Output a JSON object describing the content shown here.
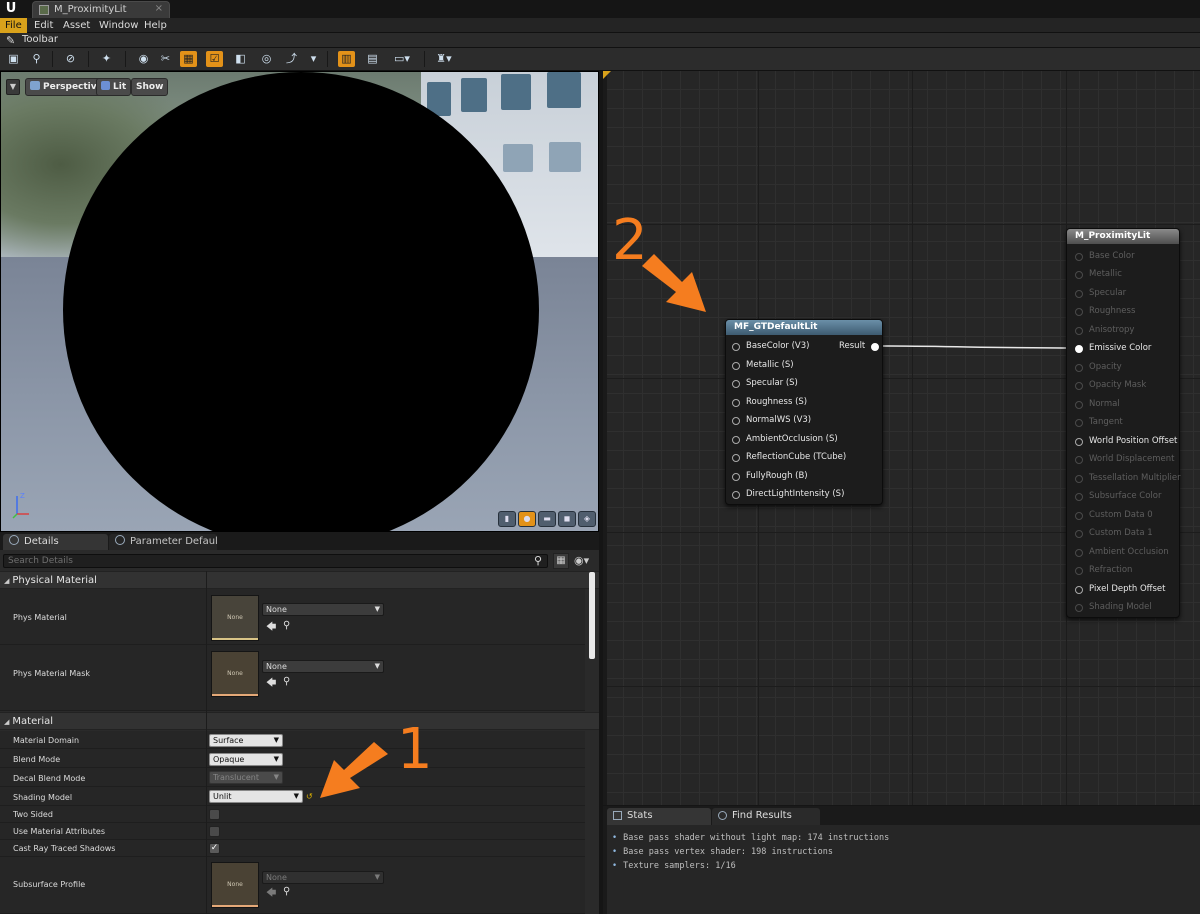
{
  "window": {
    "logo": "U",
    "tab_title": "M_ProximityLit",
    "close_glyph": "×"
  },
  "menu": [
    "File",
    "Edit",
    "Asset",
    "Window",
    "Help"
  ],
  "toolbar": {
    "tab_label": "Toolbar"
  },
  "viewport": {
    "perspective_label": "Perspective",
    "lit_label": "Lit",
    "show_label": "Show"
  },
  "details": {
    "tabs": [
      "Details",
      "Parameter Defaults"
    ],
    "search_placeholder": "Search Details",
    "physical_material": {
      "header": "Physical Material",
      "phys_material_label": "Phys Material",
      "phys_material_value": "None",
      "phys_material_thumb": "None",
      "phys_material_mask_label": "Phys Material Mask",
      "phys_material_mask_value": "None",
      "phys_material_mask_thumb": "None"
    },
    "material": {
      "header": "Material",
      "rows": [
        {
          "label": "Material Domain",
          "value": "Surface"
        },
        {
          "label": "Blend Mode",
          "value": "Opaque"
        },
        {
          "label": "Decal Blend Mode",
          "value": "Translucent"
        },
        {
          "label": "Shading Model",
          "value": "Unlit"
        },
        {
          "label": "Two Sided",
          "checked": false
        },
        {
          "label": "Use Material Attributes",
          "checked": false
        },
        {
          "label": "Cast Ray Traced Shadows",
          "checked": true
        }
      ],
      "subsurface_label": "Subsurface Profile",
      "subsurface_value": "None",
      "subsurface_thumb": "None"
    }
  },
  "graph": {
    "function_node": {
      "title": "MF_GTDefaultLit",
      "inputs": [
        "BaseColor (V3)",
        "Metallic (S)",
        "Specular (S)",
        "Roughness (S)",
        "NormalWS (V3)",
        "AmbientOcclusion (S)",
        "ReflectionCube (TCube)",
        "FullyRough (B)",
        "DirectLightIntensity (S)"
      ],
      "output": "Result"
    },
    "material_node": {
      "title": "M_ProximityLit",
      "pins": [
        {
          "label": "Base Color",
          "state": "dim"
        },
        {
          "label": "Metallic",
          "state": "dim"
        },
        {
          "label": "Specular",
          "state": "dim"
        },
        {
          "label": "Roughness",
          "state": "dim"
        },
        {
          "label": "Anisotropy",
          "state": "dim"
        },
        {
          "label": "Emissive Color",
          "state": "connected"
        },
        {
          "label": "Opacity",
          "state": "dim"
        },
        {
          "label": "Opacity Mask",
          "state": "dim"
        },
        {
          "label": "Normal",
          "state": "dim"
        },
        {
          "label": "Tangent",
          "state": "dim"
        },
        {
          "label": "World Position Offset",
          "state": "active"
        },
        {
          "label": "World Displacement",
          "state": "dim"
        },
        {
          "label": "Tessellation Multiplier",
          "state": "dim"
        },
        {
          "label": "Subsurface Color",
          "state": "dim"
        },
        {
          "label": "Custom Data 0",
          "state": "dim"
        },
        {
          "label": "Custom Data 1",
          "state": "dim"
        },
        {
          "label": "Ambient Occlusion",
          "state": "dim"
        },
        {
          "label": "Refraction",
          "state": "dim"
        },
        {
          "label": "Pixel Depth Offset",
          "state": "active"
        },
        {
          "label": "Shading Model",
          "state": "dim"
        }
      ]
    }
  },
  "annotations": {
    "step1": "1",
    "step2": "2",
    "color": "#f57d1f"
  },
  "stats": {
    "tabs": [
      "Stats",
      "Find Results"
    ],
    "lines": [
      "Base pass shader without light map: 174 instructions",
      "Base pass vertex shader: 198 instructions",
      "Texture samplers: 1/16"
    ]
  }
}
